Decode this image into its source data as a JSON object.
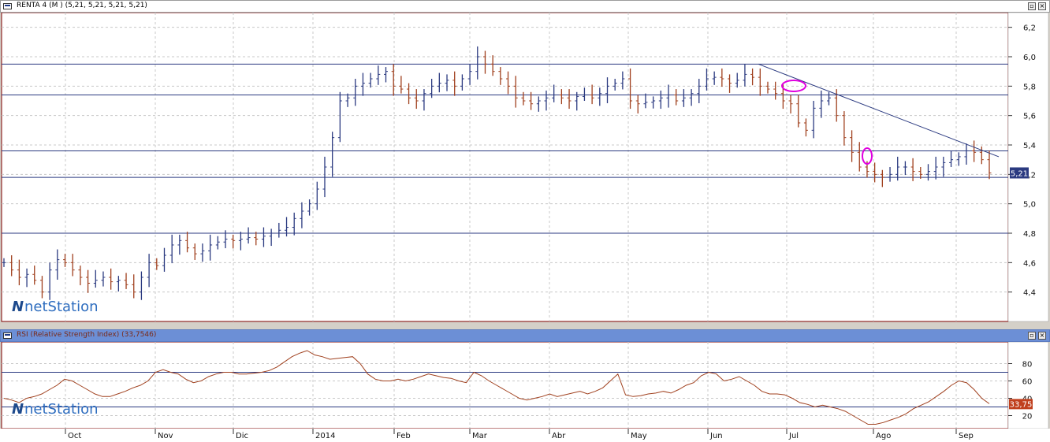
{
  "window": {
    "title": "RENTA 4 (M ) (5,21, 5,21, 5,21, 5,21)",
    "rsi_title": "RSI (Relative Strength Index) (33,7546)",
    "minimize_symbol": "▫",
    "close_symbol": "×"
  },
  "watermark": {
    "brand": "netStation",
    "logo_letter": "N"
  },
  "price_axis": {
    "ticks": [
      "6,2",
      "6,0",
      "5,8",
      "5,6",
      "5,4",
      "5,2",
      "5,0",
      "4,8",
      "4,6",
      "4,4"
    ],
    "tick_values": [
      6.2,
      6.0,
      5.8,
      5.6,
      5.4,
      5.2,
      5.0,
      4.8,
      4.6,
      4.4
    ],
    "range": [
      4.2,
      6.3
    ],
    "last_price_label": "5,21",
    "last_price": 5.21
  },
  "rsi_axis": {
    "ticks": [
      "80",
      "60",
      "40",
      "20"
    ],
    "tick_values": [
      80,
      60,
      40,
      20
    ],
    "range": [
      5,
      105
    ],
    "last_value_label": "33,75",
    "last_value": 33.75
  },
  "time_axis": {
    "labels": [
      "Oct",
      "Nov",
      "Dic",
      "2014",
      "Feb",
      "Mar",
      "Abr",
      "May",
      "Jun",
      "Jul",
      "Ago",
      "Sep"
    ]
  },
  "horizontal_levels": [
    5.95,
    5.74,
    5.36,
    5.18,
    4.8
  ],
  "rsi_levels": [
    70,
    30
  ],
  "chart_data": {
    "type": "ohlc",
    "symbol": "RENTA 4",
    "period": "daily",
    "price_range": [
      4.2,
      6.3
    ],
    "trendline": {
      "from": {
        "t": "Jun",
        "price": 5.95
      },
      "to": {
        "t": "Sep",
        "price": 5.32
      }
    },
    "closes": [
      4.6,
      4.55,
      4.5,
      4.52,
      4.48,
      4.4,
      4.55,
      4.62,
      4.6,
      4.55,
      4.5,
      4.46,
      4.48,
      4.5,
      4.47,
      4.48,
      4.45,
      4.4,
      4.5,
      4.6,
      4.58,
      4.65,
      4.72,
      4.75,
      4.7,
      4.66,
      4.68,
      4.72,
      4.74,
      4.76,
      4.75,
      4.76,
      4.77,
      4.76,
      4.78,
      4.8,
      4.82,
      4.84,
      4.9,
      4.95,
      5.0,
      5.1,
      5.25,
      5.45,
      5.7,
      5.72,
      5.8,
      5.82,
      5.85,
      5.88,
      5.9,
      5.8,
      5.78,
      5.72,
      5.7,
      5.75,
      5.8,
      5.82,
      5.84,
      5.8,
      5.85,
      5.9,
      6.0,
      5.95,
      5.9,
      5.85,
      5.8,
      5.72,
      5.7,
      5.68,
      5.7,
      5.72,
      5.74,
      5.72,
      5.7,
      5.73,
      5.74,
      5.72,
      5.75,
      5.8,
      5.82,
      5.85,
      5.7,
      5.68,
      5.69,
      5.7,
      5.72,
      5.74,
      5.7,
      5.72,
      5.75,
      5.8,
      5.85,
      5.86,
      5.85,
      5.82,
      5.84,
      5.88,
      5.86,
      5.8,
      5.78,
      5.75,
      5.7,
      5.68,
      5.55,
      5.5,
      5.65,
      5.7,
      5.72,
      5.6,
      5.45,
      5.35,
      5.25,
      5.22,
      5.2,
      5.18,
      5.2,
      5.25,
      5.25,
      5.22,
      5.2,
      5.22,
      5.25,
      5.28,
      5.3,
      5.32,
      5.36,
      5.35,
      5.3,
      5.21
    ],
    "rsi_values": [
      40,
      38,
      35,
      40,
      42,
      45,
      50,
      55,
      62,
      60,
      55,
      50,
      45,
      42,
      42,
      45,
      48,
      52,
      55,
      60,
      70,
      73,
      70,
      68,
      62,
      58,
      60,
      65,
      68,
      70,
      70,
      68,
      68,
      69,
      70,
      72,
      76,
      82,
      88,
      92,
      95,
      90,
      88,
      85,
      86,
      87,
      88,
      80,
      68,
      62,
      60,
      60,
      62,
      60,
      62,
      65,
      68,
      66,
      64,
      63,
      60,
      58,
      70,
      66,
      60,
      55,
      50,
      45,
      40,
      38,
      40,
      42,
      45,
      42,
      44,
      46,
      48,
      45,
      48,
      52,
      60,
      68,
      44,
      42,
      43,
      45,
      46,
      48,
      46,
      50,
      55,
      58,
      66,
      70,
      68,
      60,
      62,
      65,
      60,
      55,
      48,
      45,
      45,
      44,
      40,
      35,
      33,
      30,
      32,
      30,
      28,
      25,
      20,
      15,
      10,
      10,
      12,
      15,
      18,
      22,
      28,
      32,
      36,
      42,
      48,
      55,
      60,
      58,
      50,
      40,
      33.75
    ]
  }
}
